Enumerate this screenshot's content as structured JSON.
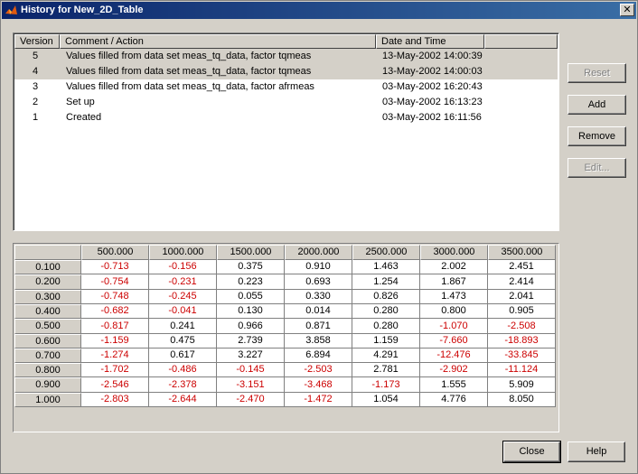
{
  "window": {
    "title": "History for New_2D_Table",
    "close_glyph": "✕"
  },
  "history": {
    "columns": [
      "Version",
      "Comment / Action",
      "Date and Time"
    ],
    "rows": [
      {
        "version": "5",
        "comment": "Values filled from data set meas_tq_data, factor tqmeas",
        "datetime": "13-May-2002 14:00:39",
        "selected": true
      },
      {
        "version": "4",
        "comment": "Values filled from data set meas_tq_data, factor tqmeas",
        "datetime": "13-May-2002 14:00:03",
        "selected": true
      },
      {
        "version": "3",
        "comment": "Values filled from data set meas_tq_data, factor afrmeas",
        "datetime": "03-May-2002 16:20:43",
        "selected": false
      },
      {
        "version": "2",
        "comment": "Set up",
        "datetime": "03-May-2002 16:13:23",
        "selected": false
      },
      {
        "version": "1",
        "comment": "Created",
        "datetime": "03-May-2002 16:11:56",
        "selected": false
      }
    ]
  },
  "buttons": {
    "reset": "Reset",
    "add": "Add",
    "remove": "Remove",
    "edit": "Edit...",
    "close": "Close",
    "help": "Help"
  },
  "table": {
    "col_headers": [
      "500.000",
      "1000.000",
      "1500.000",
      "2000.000",
      "2500.000",
      "3000.000",
      "3500.000"
    ],
    "row_headers": [
      "0.100",
      "0.200",
      "0.300",
      "0.400",
      "0.500",
      "0.600",
      "0.700",
      "0.800",
      "0.900",
      "1.000"
    ],
    "values": [
      [
        "-0.713",
        "-0.156",
        "0.375",
        "0.910",
        "1.463",
        "2.002",
        "2.451"
      ],
      [
        "-0.754",
        "-0.231",
        "0.223",
        "0.693",
        "1.254",
        "1.867",
        "2.414"
      ],
      [
        "-0.748",
        "-0.245",
        "0.055",
        "0.330",
        "0.826",
        "1.473",
        "2.041"
      ],
      [
        "-0.682",
        "-0.041",
        "0.130",
        "0.014",
        "0.280",
        "0.800",
        "0.905"
      ],
      [
        "-0.817",
        "0.241",
        "0.966",
        "0.871",
        "0.280",
        "-1.070",
        "-2.508"
      ],
      [
        "-1.159",
        "0.475",
        "2.739",
        "3.858",
        "1.159",
        "-7.660",
        "-18.893"
      ],
      [
        "-1.274",
        "0.617",
        "3.227",
        "6.894",
        "4.291",
        "-12.476",
        "-33.845"
      ],
      [
        "-1.702",
        "-0.486",
        "-0.145",
        "-2.503",
        "2.781",
        "-2.902",
        "-11.124"
      ],
      [
        "-2.546",
        "-2.378",
        "-3.151",
        "-3.468",
        "-1.173",
        "1.555",
        "5.909"
      ],
      [
        "-2.803",
        "-2.644",
        "-2.470",
        "-1.472",
        "1.054",
        "4.776",
        "8.050"
      ]
    ],
    "negative_color": "#cc0000"
  }
}
